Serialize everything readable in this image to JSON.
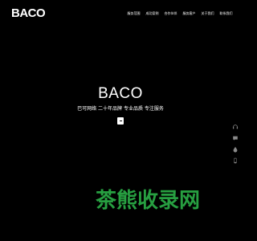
{
  "header": {
    "logo": "BACO",
    "nav": [
      {
        "label": "服务范围"
      },
      {
        "label": "成功案例"
      },
      {
        "label": "合作伙伴"
      },
      {
        "label": "服务客户"
      },
      {
        "label": "关于我们"
      },
      {
        "label": "联系我们"
      }
    ]
  },
  "hero": {
    "title": "BACO",
    "subtitle": "巴可网络 二十年品牌 专业品质 专注服务"
  },
  "sidebar": {
    "buttons": [
      {
        "icon": "headset-icon"
      },
      {
        "icon": "chat-icon"
      },
      {
        "icon": "drop-icon"
      },
      {
        "icon": "phone-icon"
      }
    ]
  },
  "watermark": {
    "text": "茶熊收录网"
  },
  "colors": {
    "background": "#000000",
    "text": "#ffffff",
    "watermark": "#2aa845",
    "icon": "#8a8a8a"
  }
}
